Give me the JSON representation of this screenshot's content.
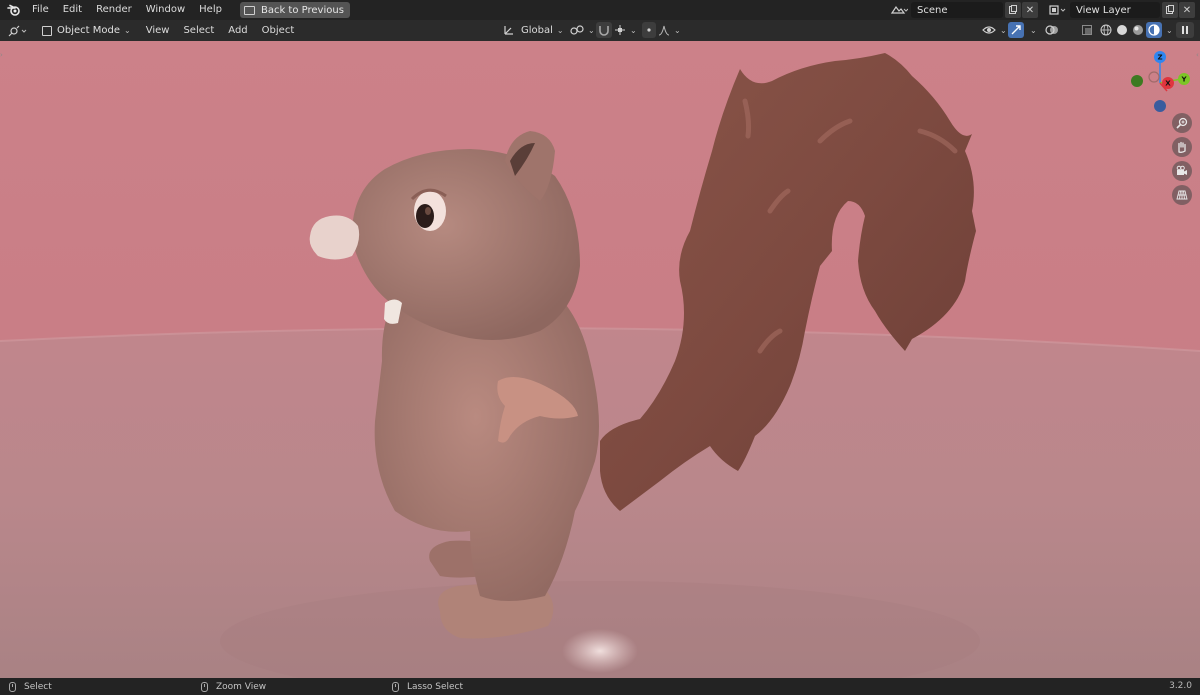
{
  "menubar": {
    "items": [
      "File",
      "Edit",
      "Render",
      "Window",
      "Help"
    ],
    "back_button": "Back to Previous",
    "scene_field": "Scene",
    "view_layer_field": "View Layer"
  },
  "header": {
    "mode": "Object Mode",
    "menus": [
      "View",
      "Select",
      "Add",
      "Object"
    ],
    "transform_orientation": "Global"
  },
  "gizmo": {
    "axes": {
      "z": "Z",
      "y": "Y",
      "x": "X"
    },
    "colors": {
      "x": "#e0353e",
      "y": "#7cc626",
      "z": "#2f86f0",
      "neg_y": "#3d7a21",
      "neg_z": "#3a5c9e"
    }
  },
  "nav_tools": [
    "zoom-icon",
    "hand-pan-icon",
    "camera-icon",
    "grid-perspective-icon"
  ],
  "statusbar": {
    "items": [
      "Select",
      "Zoom View",
      "Lasso Select"
    ],
    "version": "3.2.0"
  },
  "colors": {
    "background_wall": "#c97e87",
    "floor": "#b58488",
    "accent": "#4772b3",
    "squirrel_body": "#a6786f",
    "squirrel_tail": "#7a4a40"
  }
}
